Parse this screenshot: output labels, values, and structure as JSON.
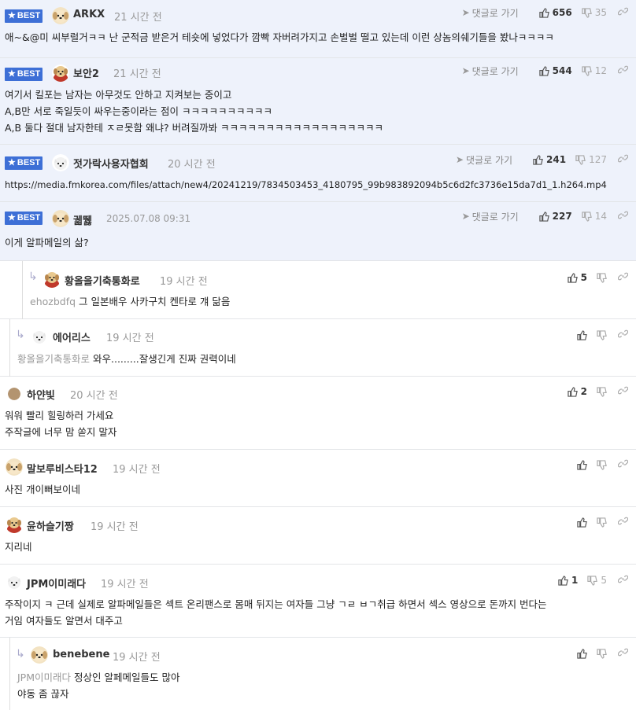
{
  "labels": {
    "best": "BEST",
    "goto_reply": "댓글로 가기"
  },
  "colors": {
    "accent": "#3d6fd6",
    "best_bg": "#eef2fb"
  },
  "comments": [
    {
      "nick": "ARKX",
      "time": "21 시간 전",
      "up": "656",
      "down": "35",
      "lines": [
        "애~&@미 씨부럴거ㅋㅋ 난 군적금 받은거 테숏에 넣었다가 깜빡 자버려가지고 손벌벌 떨고 있는데 이런 상놈의쉐기들을 봤나ㅋㅋㅋㅋ"
      ]
    },
    {
      "nick": "보안2",
      "time": "21 시간 전",
      "up": "544",
      "down": "12",
      "lines": [
        "여기서 킬포는 남자는 아무것도 안하고 지켜보는 중이고",
        "A,B만 서로 죽일듯이 싸우는중이라는 점이 ㅋㅋㅋㅋㅋㅋㅋㅋㅋㅋ",
        "A,B 둘다 절대 남자한테 ㅈㄹ못함 왜냐? 버려질까봐 ㅋㅋㅋㅋㅋㅋㅋㅋㅋㅋㅋㅋㅋㅋㅋㅋㅋㅋ"
      ]
    },
    {
      "nick": "젓가락사용자협회",
      "time": "20 시간 전",
      "up": "241",
      "down": "127",
      "lines": [
        "https://media.fmkorea.com/files/attach/new4/20241219/7834503453_4180795_99b983892094b5c6d2fc3736e15da7d1_1.h264.mp4"
      ]
    },
    {
      "nick": "궯뛣",
      "time": "2025.07.08 09:31",
      "up": "227",
      "down": "14",
      "lines": [
        "이게 알파메일의 삶?"
      ]
    },
    {
      "nick": "황올을기축통화로",
      "time": "19 시간 전",
      "up": "5",
      "down": "",
      "mention": "ehozbdfq",
      "lines": [
        "그 일본배우 사카구치 켄타로 걔 닮음"
      ]
    },
    {
      "nick": "에어리스",
      "time": "19 시간 전",
      "up": "",
      "down": "",
      "mention": "황올을기축통화로",
      "lines": [
        "와우.........잘생긴게 진짜 권력이네"
      ]
    },
    {
      "nick": "하얀빛",
      "time": "20 시간 전",
      "up": "2",
      "down": "",
      "lines": [
        "워워 빨리 힐링하러 가세요",
        "주작글에 너무 맘 쏟지 말자"
      ]
    },
    {
      "nick": "말보루비스타12",
      "time": "19 시간 전",
      "up": "",
      "down": "",
      "lines": [
        "사진 개이뻐보이네"
      ]
    },
    {
      "nick": "윤하슬기짱",
      "time": "19 시간 전",
      "up": "",
      "down": "",
      "lines": [
        "지리네"
      ]
    },
    {
      "nick": "JPM이미래다",
      "time": "19 시간 전",
      "up": "1",
      "down": "5",
      "lines": [
        "주작이지 ㅋ 근데 실제로 알파메일들은 섹트 온리팬스로 몸매 뒤지는 여자들 그냥 ㄱㄹ ㅂㄱ취급 하면서 섹스 영상으로 돈까지 번다는",
        "거임 여자들도 알면서 대주고"
      ]
    },
    {
      "nick": "benebene",
      "time": "19 시간 전",
      "up": "",
      "down": "",
      "mention": "JPM이미래다",
      "lines": [
        "정상인 알페메일들도 많아",
        "야동 좀 끊자"
      ]
    }
  ]
}
